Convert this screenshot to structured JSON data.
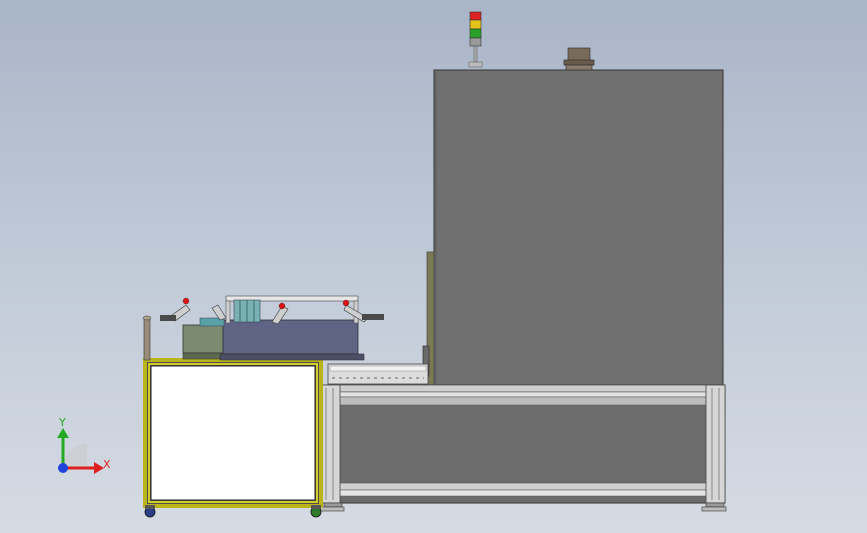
{
  "viewport": {
    "title": "",
    "background_top": "#a9b5c8",
    "background_bottom": "#d6dbe3"
  },
  "triad": {
    "x_label": "X",
    "y_label": "Y",
    "x_color": "#e02020",
    "y_color": "#22aa22",
    "z_color": "#2244dd"
  },
  "model": {
    "cabinet_color": "#707070",
    "frame_color": "#c8c41c",
    "stack_light": {
      "lamps": [
        "red",
        "yellow",
        "green"
      ]
    }
  }
}
